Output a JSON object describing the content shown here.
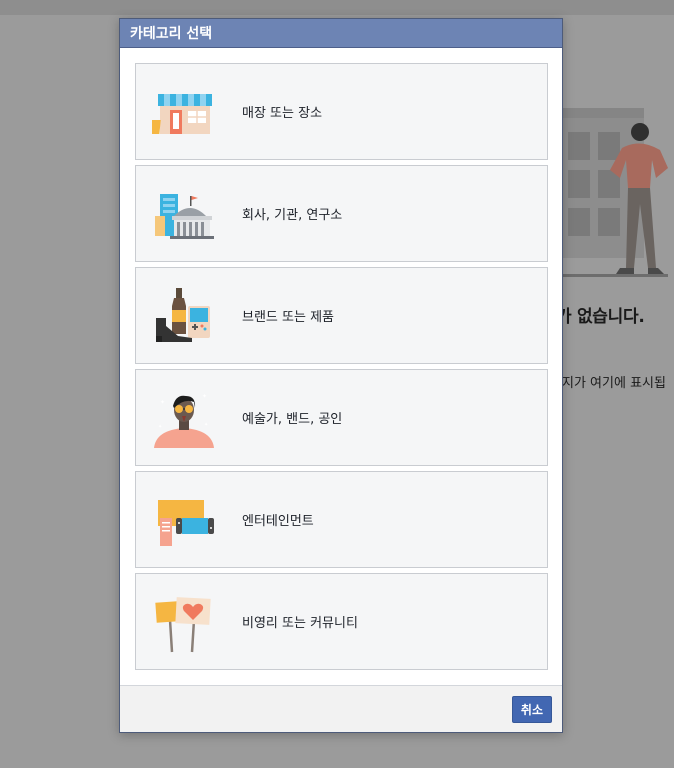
{
  "dialog": {
    "title": "카테고리 선택",
    "cancel_label": "취소"
  },
  "categories": [
    {
      "label": "매장 또는 장소",
      "icon": "storefront-icon"
    },
    {
      "label": "회사, 기관, 연구소",
      "icon": "institution-buildings-icon"
    },
    {
      "label": "브랜드 또는 제품",
      "icon": "products-icon"
    },
    {
      "label": "예술가, 밴드, 공인",
      "icon": "public-figure-icon"
    },
    {
      "label": "엔터테인먼트",
      "icon": "entertainment-icon"
    },
    {
      "label": "비영리 또는 커뮤니티",
      "icon": "community-signs-icon"
    }
  ],
  "background_page": {
    "heading_fragment": "가 없습니다.",
    "subtext_fragment": "지가 여기에 표시됩"
  },
  "colors": {
    "header": "#6d84b4",
    "button": "#4267b2",
    "overlay": "#9b9b9b",
    "item_bg": "#f5f6f7"
  }
}
